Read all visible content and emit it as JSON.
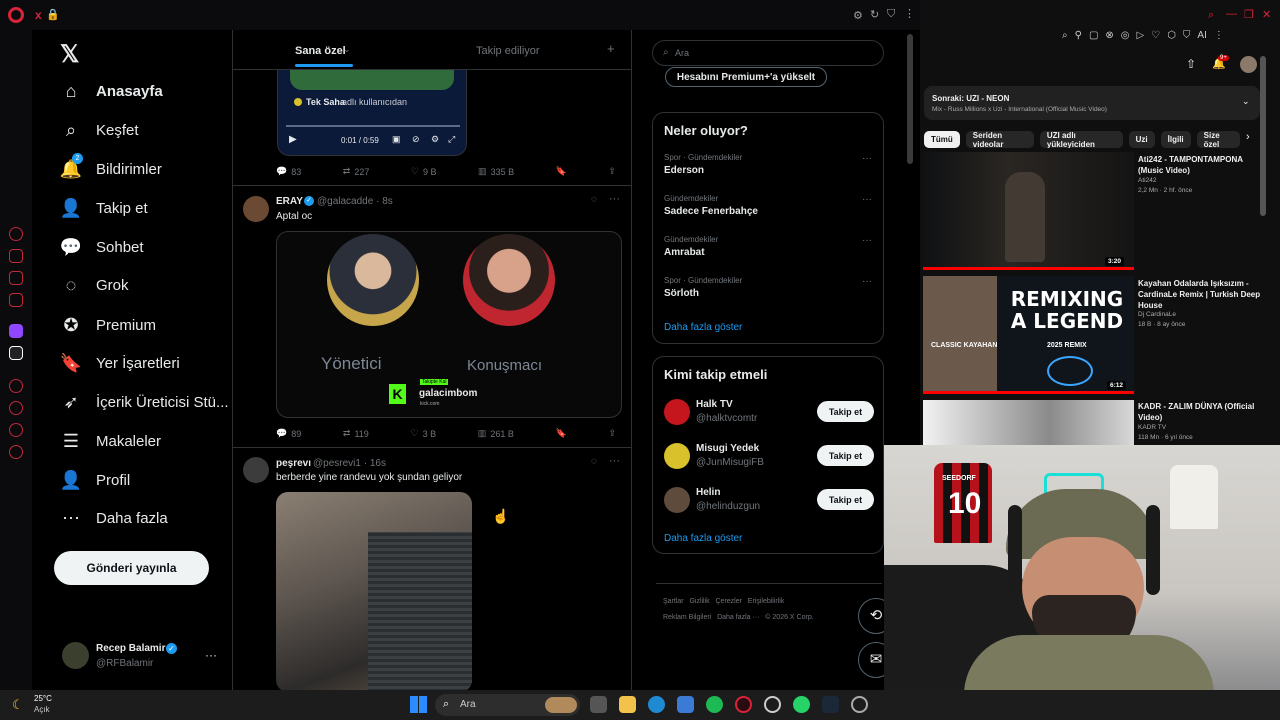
{
  "browser": {
    "tab_close": "x"
  },
  "x": {
    "nav": [
      {
        "label": "Anasayfa",
        "icon": "home-icon"
      },
      {
        "label": "Keşfet",
        "icon": "search-icon"
      },
      {
        "label": "Bildirimler",
        "icon": "bell-icon",
        "badge": "2"
      },
      {
        "label": "Takip et",
        "icon": "follow-icon"
      },
      {
        "label": "Sohbet",
        "icon": "chat-icon"
      },
      {
        "label": "Grok",
        "icon": "grok-icon"
      },
      {
        "label": "Premium",
        "icon": "premium-icon"
      },
      {
        "label": "Yer İşaretleri",
        "icon": "bookmark-icon"
      },
      {
        "label": "İçerik Üreticisi Stü...",
        "icon": "rocket-icon"
      },
      {
        "label": "Makaleler",
        "icon": "article-icon"
      },
      {
        "label": "Profil",
        "icon": "profile-icon"
      },
      {
        "label": "Daha fazla",
        "icon": "more-icon"
      }
    ],
    "post_button": "Gönderi yayınla",
    "account": {
      "name": "Recep Balamir",
      "handle": "@RFBalamir",
      "more": "···"
    },
    "tabs": {
      "for_you": "Sana özel",
      "following": "Takip ediliyor"
    },
    "tweet0": {
      "quoted_name": "Tek Saha",
      "quoted_suffix": "adlı kullanıcıdan",
      "time": "0:01 / 0:59",
      "replies": "83",
      "retweets": "227",
      "likes": "9 B",
      "views": "335 B"
    },
    "tweet1": {
      "name": "ERAY",
      "handle": "@galacadde · 8s",
      "text": "Aptal oc",
      "card_left": "Yönetici",
      "card_right": "Konuşmacı",
      "brand": "galacimbom",
      "brand_sub": "kick.com",
      "brand_tag": "Takipte Kal",
      "replies": "89",
      "retweets": "119",
      "likes": "3 B",
      "views": "261 B"
    },
    "tweet2": {
      "name": "peşrevı",
      "handle": "@pesrevi1 · 16s",
      "text": "berberde yine randevu yok şundan geliyor"
    },
    "search_placeholder": "Ara",
    "premium_button": "Hesabını Premium+'a yükselt",
    "trends": {
      "title": "Neler oluyor?",
      "items": [
        {
          "meta": "Spor · Gündemdekiler",
          "name": "Ederson"
        },
        {
          "meta": "Gündemdekiler",
          "name": "Sadece Fenerbahçe"
        },
        {
          "meta": "Gündemdekiler",
          "name": "Amrabat"
        },
        {
          "meta": "Spor · Gündemdekiler",
          "name": "Sörloth"
        }
      ],
      "show_more": "Daha fazla göster"
    },
    "who_to_follow": {
      "title": "Kimi takip etmeli",
      "items": [
        {
          "name": "Halk TV",
          "handle": "@halktvcomtr",
          "button": "Takip et"
        },
        {
          "name": "Misugi Yedek",
          "handle": "@JunMisugiFB",
          "button": "Takip et"
        },
        {
          "name": "Helin",
          "handle": "@helinduzgun",
          "button": "Takip et"
        }
      ],
      "show_more": "Daha fazla göster"
    },
    "footer": {
      "l1": "Şartlar   Gizlilik   Çerezler   Erişilebilirlik",
      "l2": "Reklam Bilgileri   Daha fazla ···   © 2026 X Corp."
    }
  },
  "youtube": {
    "up_next_label": "Sonraki: UZI - NEON",
    "up_next_sub": "Mix - Russ Millions x Uzi - International (Official Music Video)",
    "notif_badge": "9+",
    "chips": [
      "Tümü",
      "Seriden videolar",
      "UZI adlı yükleyiciden",
      "Uzi",
      "İlgili",
      "Size özel"
    ],
    "videos": [
      {
        "title": "Ati242 - TAMPONTAMPONA (Music Video)",
        "channel": "Ati242",
        "meta": "2,2 Mn · 2 hf. önce",
        "duration": "3:20"
      },
      {
        "title": "Kayahan Odalarda Işıksızım - CardinaLe Remix | Turkish Deep House",
        "channel": "Dj CardinaLe",
        "meta": "18 B · 8 ay önce",
        "duration": "6:12",
        "thumb_text": "REMIXING A LEGEND",
        "thumb_left": "CLASSIC KAYAHAN",
        "thumb_right": "2025 REMIX"
      },
      {
        "title": "KADR - ZALIM DÜNYA (Official Video)",
        "channel": "KADR TV",
        "meta": "118 Mn · 6 yıl önce"
      }
    ]
  },
  "taskbar": {
    "temp": "25°C",
    "weather": "Açık",
    "search": "Ara"
  },
  "webcam": {
    "jersey_number": "10",
    "jersey_name": "SEEDORF"
  }
}
